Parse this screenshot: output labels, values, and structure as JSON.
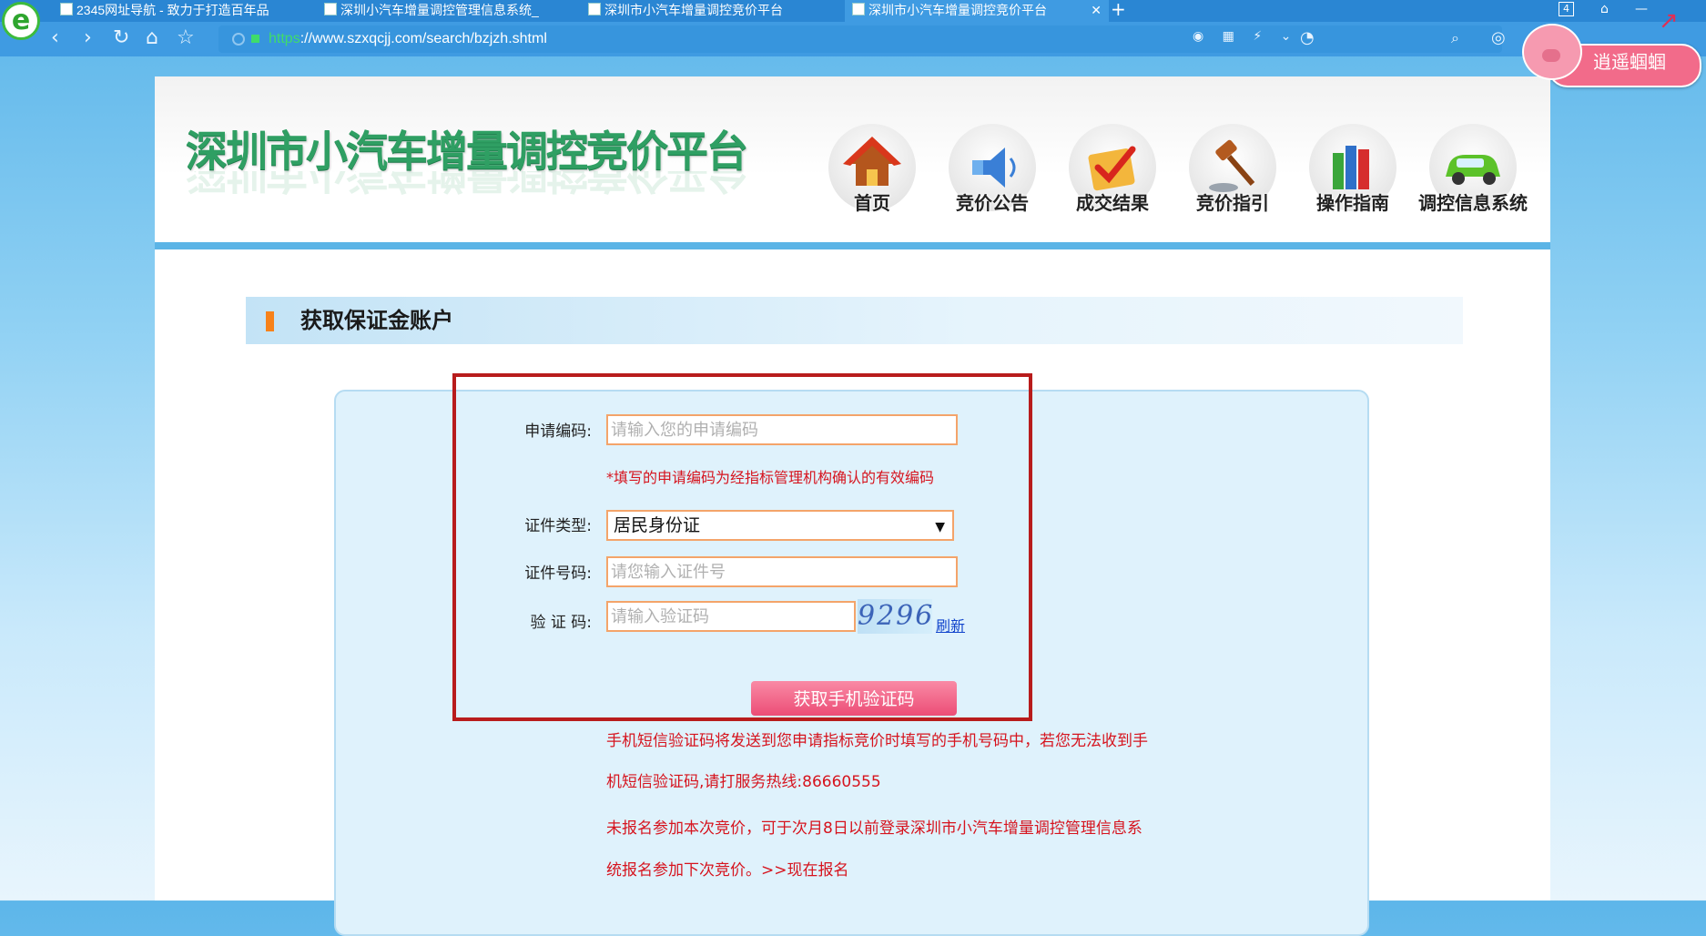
{
  "browser": {
    "tabs": [
      {
        "label": "2345网址导航 - 致力于打造百年品"
      },
      {
        "label": "深圳小汽车增量调控管理信息系统_"
      },
      {
        "label": "深圳市小汽车增量调控竞价平台"
      },
      {
        "label": "深圳市小汽车增量调控竞价平台"
      }
    ],
    "tab_count": "4",
    "url_scheme": "https",
    "url_rest": "://www.szxqcjj.com/search/bzjzh.shtml",
    "mascot_text": "逍遥蝈蝈"
  },
  "site": {
    "title": "深圳市小汽车增量调控竞价平台",
    "nav": [
      {
        "label": "首页",
        "icon": "house-icon"
      },
      {
        "label": "竞价公告",
        "icon": "megaphone-icon"
      },
      {
        "label": "成交结果",
        "icon": "checkmark-icon"
      },
      {
        "label": "竞价指引",
        "icon": "gavel-icon"
      },
      {
        "label": "操作指南",
        "icon": "books-icon"
      },
      {
        "label": "调控信息系统",
        "icon": "car-icon"
      }
    ]
  },
  "section": {
    "title": "获取保证金账户"
  },
  "form": {
    "app_code_label": "申请编码:",
    "app_code_placeholder": "请输入您的申请编码",
    "app_code_hint": "*填写的申请编码为经指标管理机构确认的有效编码",
    "id_type_label": "证件类型:",
    "id_type_value": "居民身份证",
    "id_number_label": "证件号码:",
    "id_number_placeholder": "请您输入证件号",
    "captcha_label": "验 证 码:",
    "captcha_placeholder": "请输入验证码",
    "captcha_text": "9296",
    "refresh_label": "刷新",
    "submit_label": "获取手机验证码"
  },
  "notes": {
    "sms_line1": "手机短信验证码将发送到您申请指标竞价时填写的手机号码中，若您无法收到手",
    "sms_line2": "机短信验证码,请打服务热线:86660555",
    "reg_line1": "未报名参加本次竞价，可于次月8日以前登录深圳市小汽车增量调控管理信息系",
    "reg_line2": "统报名参加下次竞价。>>现在报名"
  },
  "colors": {
    "title_green": "#2f9f63",
    "warning_red": "#d6141e",
    "highlight_border": "#b81c1c",
    "button_pink": "#ec4d76"
  }
}
